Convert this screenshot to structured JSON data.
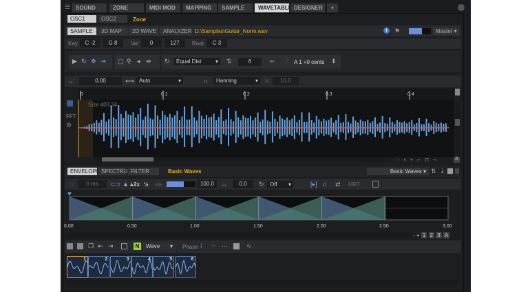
{
  "tabs": [
    "SOUND",
    "ZONE",
    "MIDI MOD",
    "MAPPING",
    "SAMPLE",
    "WAVETABLE",
    "DESIGNER"
  ],
  "add_tab": "+",
  "osc_tabs": [
    "OSC1",
    "OSC2"
  ],
  "zone_label": "Zone",
  "view_tabs": [
    "SAMPLE",
    "3D MAP",
    "2D WAVE",
    "ANALYZER"
  ],
  "file_path": "D:\\Samples\\Guitar_Norm.wav",
  "output": "Master",
  "key": {
    "label": "Key",
    "low": "C -2",
    "high": "G 8",
    "vel_label": "Vel",
    "vel_low": "0",
    "vel_high": "127",
    "root_label": "Root",
    "root": "C 3"
  },
  "toolbar": {
    "mode": "Equal Dist",
    "count": "6",
    "pitch": "A  1 +0 cents"
  },
  "params": {
    "offset": "0.00",
    "auto": "Auto",
    "window": "Hanning",
    "value": "10.0"
  },
  "ruler": [
    "0",
    "0.1",
    "0.2",
    "0.3",
    "0.4"
  ],
  "size_readout": "Size 403.34",
  "fft_label": "FFT",
  "waveform_progress_fraction": 0.17,
  "env_tabs": [
    "ENVELOPE",
    "SPECTRUM",
    "FILTER"
  ],
  "preset_name": "Basic Waves",
  "preset_select": "Basic Waves",
  "env": {
    "time": "0 ms",
    "mult": "2x",
    "half": "½",
    "level": "100.0",
    "level_fraction": 0.6,
    "offset": "0.0",
    "loop": "Off",
    "mode": "MRT"
  },
  "env_axis": [
    "0.00",
    "0.50",
    "1.00",
    "1.50",
    "2.00",
    "2.50",
    "3.00"
  ],
  "zoom_buttons": [
    "-",
    "+",
    "1",
    "2",
    "3",
    "A"
  ],
  "wave_tools": {
    "n": "N",
    "wave": "Wave",
    "phase": "Phase"
  },
  "waves": [
    "1",
    "2",
    "3",
    "4",
    "5",
    "6"
  ],
  "colors": {
    "accent": "#e0b020",
    "wave": "#6aa3dc",
    "line": "#e05050"
  }
}
